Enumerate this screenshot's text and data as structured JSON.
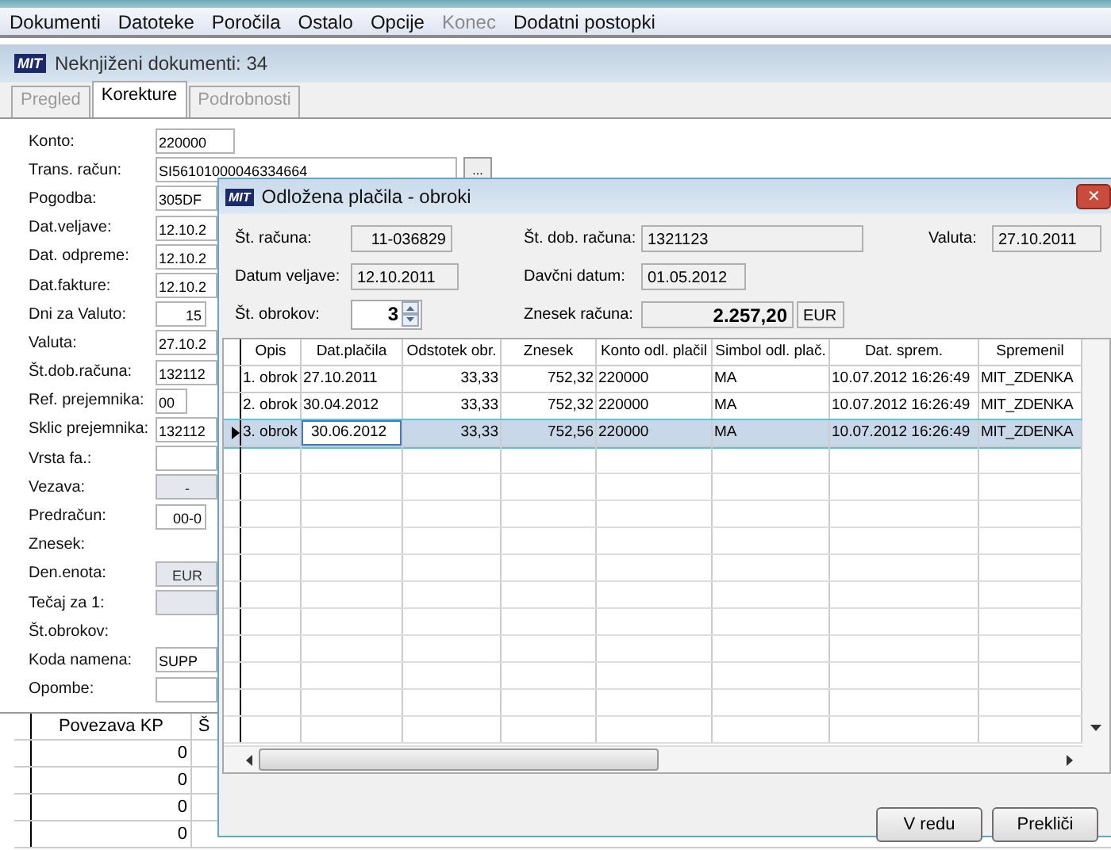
{
  "menu": [
    {
      "label": "Dokumenti",
      "disabled": false
    },
    {
      "label": "Datoteke",
      "disabled": false
    },
    {
      "label": "Poročila",
      "disabled": false
    },
    {
      "label": "Ostalo",
      "disabled": false
    },
    {
      "label": "Opcije",
      "disabled": false
    },
    {
      "label": "Konec",
      "disabled": true
    },
    {
      "label": "Dodatni postopki",
      "disabled": false
    }
  ],
  "header": {
    "logo": "MIT",
    "title": "Neknjiženi dokumenti: 34"
  },
  "tabs": [
    {
      "label": "Pregled",
      "selected": false,
      "disabled": true
    },
    {
      "label": "Korekture",
      "selected": true,
      "disabled": false
    },
    {
      "label": "Podrobnosti",
      "selected": false,
      "disabled": true
    }
  ],
  "form": [
    {
      "label": "Konto:",
      "value": "220000",
      "kind": "text"
    },
    {
      "label": "Trans. račun:",
      "value": "SI56101000046334664",
      "kind": "browse",
      "button": "..."
    },
    {
      "label": "Pogodba:",
      "value": "305DF",
      "kind": "text"
    },
    {
      "label": "Dat.veljave:",
      "value": "12.10.2",
      "kind": "text"
    },
    {
      "label": "Dat. odpreme:",
      "value": "12.10.2",
      "kind": "text"
    },
    {
      "label": "Dat.fakture:",
      "value": "12.10.2",
      "kind": "text"
    },
    {
      "label": "Dni za Valuto:",
      "value": "15",
      "kind": "number"
    },
    {
      "label": "Valuta:",
      "value": "27.10.2",
      "kind": "text"
    },
    {
      "label": "Št.dob.računa:",
      "value": "132112",
      "kind": "text"
    },
    {
      "label": "Ref. prejemnika:",
      "value": "00",
      "kind": "small"
    },
    {
      "label": "Sklic prejemnika:",
      "value": "132112",
      "kind": "text"
    },
    {
      "label": "Vrsta fa.:",
      "kind": "text"
    },
    {
      "label": "Vezava:",
      "value": "-",
      "kind": "grey"
    },
    {
      "label": "Predračun:",
      "value": "00-0",
      "kind": "number"
    },
    {
      "label": "Znesek:",
      "kind": "blank"
    },
    {
      "label": "Den.enota:",
      "value": "EUR",
      "kind": "grey"
    },
    {
      "label": "Tečaj za 1:",
      "kind": "grey"
    },
    {
      "label": "Št.obrokov:",
      "kind": "blank"
    },
    {
      "label": "Koda namena:",
      "value": "SUPP",
      "kind": "text"
    },
    {
      "label": "Opombe:",
      "kind": "text"
    }
  ],
  "links_table": {
    "columns": [
      "Povezava KP",
      "Š"
    ],
    "rows": [
      [
        "0"
      ],
      [
        "0"
      ],
      [
        "0"
      ],
      [
        "0"
      ]
    ]
  },
  "dialog": {
    "logo": "MIT",
    "title": "Odložena plačila - obroki",
    "close": "✕",
    "fields": [
      [
        {
          "label": "Št. računa:",
          "value": "11-036829",
          "kind": "right"
        },
        {
          "label": "Št. dob. računa:",
          "value": "1321123",
          "kind": "left"
        },
        {
          "label": "Valuta:",
          "value": "27.10.2011",
          "kind": "left"
        }
      ],
      [
        {
          "label": "Datum veljave:",
          "value": "12.10.2011",
          "kind": "left"
        },
        {
          "label": "Davčni datum:",
          "value": "01.05.2012",
          "kind": "left"
        }
      ],
      [
        {
          "label": "Št. obrokov:",
          "value": "3",
          "kind": "spinner"
        },
        {
          "label": "Znesek računa:",
          "value": "2.257,20",
          "kind": "amount",
          "unit": "EUR"
        }
      ]
    ],
    "table": {
      "columns": [
        "Opis",
        "Dat.plačila",
        "Odstotek obr.",
        "Znesek",
        "Konto odl. plačil",
        "Simbol odl. plač.",
        "Dat. sprem.",
        "Spremenil"
      ],
      "rows": [
        {
          "cells": [
            "1. obrok",
            "27.10.2011",
            "33,33",
            "752,32",
            "220000",
            "MA",
            "10.07.2012 16:26:49",
            "MIT_ZDENKA"
          ],
          "selected": false
        },
        {
          "cells": [
            "2. obrok",
            "30.04.2012",
            "33,33",
            "752,32",
            "220000",
            "MA",
            "10.07.2012 16:26:49",
            "MIT_ZDENKA"
          ],
          "selected": false
        },
        {
          "cells": [
            "3. obrok",
            "30.06.2012",
            "33,33",
            "752,56",
            "220000",
            "MA",
            "10.07.2012 16:26:49",
            "MIT_ZDENKA"
          ],
          "selected": true
        }
      ]
    },
    "buttons": [
      "V redu",
      "Prekliči"
    ]
  }
}
